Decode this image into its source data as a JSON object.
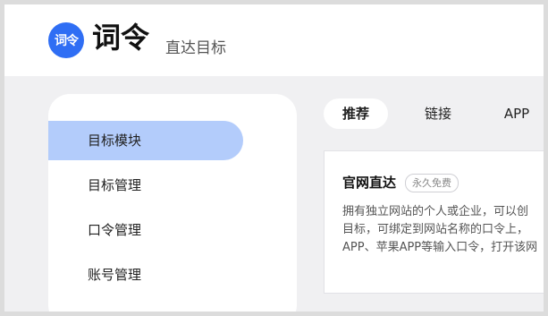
{
  "header": {
    "logo_text": "词令",
    "brand": "词令",
    "tagline": "直达目标"
  },
  "sidebar": {
    "items": [
      {
        "label": "目标模块",
        "active": true
      },
      {
        "label": "目标管理",
        "active": false
      },
      {
        "label": "口令管理",
        "active": false
      },
      {
        "label": "账号管理",
        "active": false
      }
    ]
  },
  "tabs": [
    {
      "label": "推荐",
      "active": true
    },
    {
      "label": "链接",
      "active": false
    },
    {
      "label": "APP",
      "active": false
    }
  ],
  "card": {
    "title": "官网直达",
    "badge": "永久免费",
    "desc_lines": [
      "拥有独立网站的个人或企业，可以创",
      "目标，可绑定到网站名称的口令上，",
      "APP、苹果APP等输入口令，打开该网"
    ]
  },
  "colors": {
    "accent": "#2f6ef4",
    "active_item_bg": "#b3ccfb",
    "page_bg": "#f0f0f2"
  }
}
